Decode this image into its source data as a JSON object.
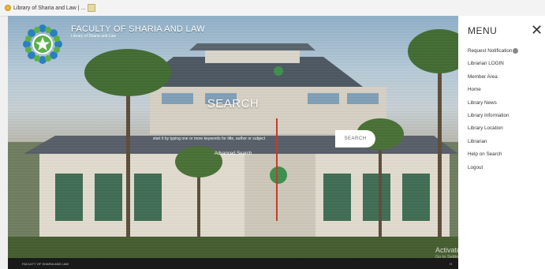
{
  "browser": {
    "tab_title": "Library of Sharia and Law | ...",
    "tab_close": "×"
  },
  "site": {
    "title": "FACULTY OF SHARIA AND LAW",
    "subtitle": "Library of Sharia and Law"
  },
  "search": {
    "heading": "SEARCH",
    "placeholder": "start it by typing one or more keywords for title, author or subject",
    "button_label": "SEARCH",
    "advanced_label": "Advanced Search"
  },
  "menu": {
    "heading": "MENU",
    "close_symbol": "✕",
    "items": [
      {
        "label": "Request Notification"
      },
      {
        "label": "Librarian LOGIN"
      },
      {
        "label": "Member Area"
      },
      {
        "label": "Home"
      },
      {
        "label": "Library News"
      },
      {
        "label": "Library Information"
      },
      {
        "label": "Library Location"
      },
      {
        "label": "Librarian"
      },
      {
        "label": "Help on Search"
      },
      {
        "label": "Logout"
      }
    ]
  },
  "footer": {
    "left": "FACULTY OF SHARIA AND LAW",
    "right": "H"
  },
  "watermark": {
    "line1": "Activate Windows",
    "line2": "Go to Settings to activate Windows."
  },
  "colors": {
    "menu_bg": "#ffffff",
    "footer_bg": "#1a1a1a",
    "logo_blue": "#2a7fc0",
    "logo_green": "#5bb04a"
  }
}
